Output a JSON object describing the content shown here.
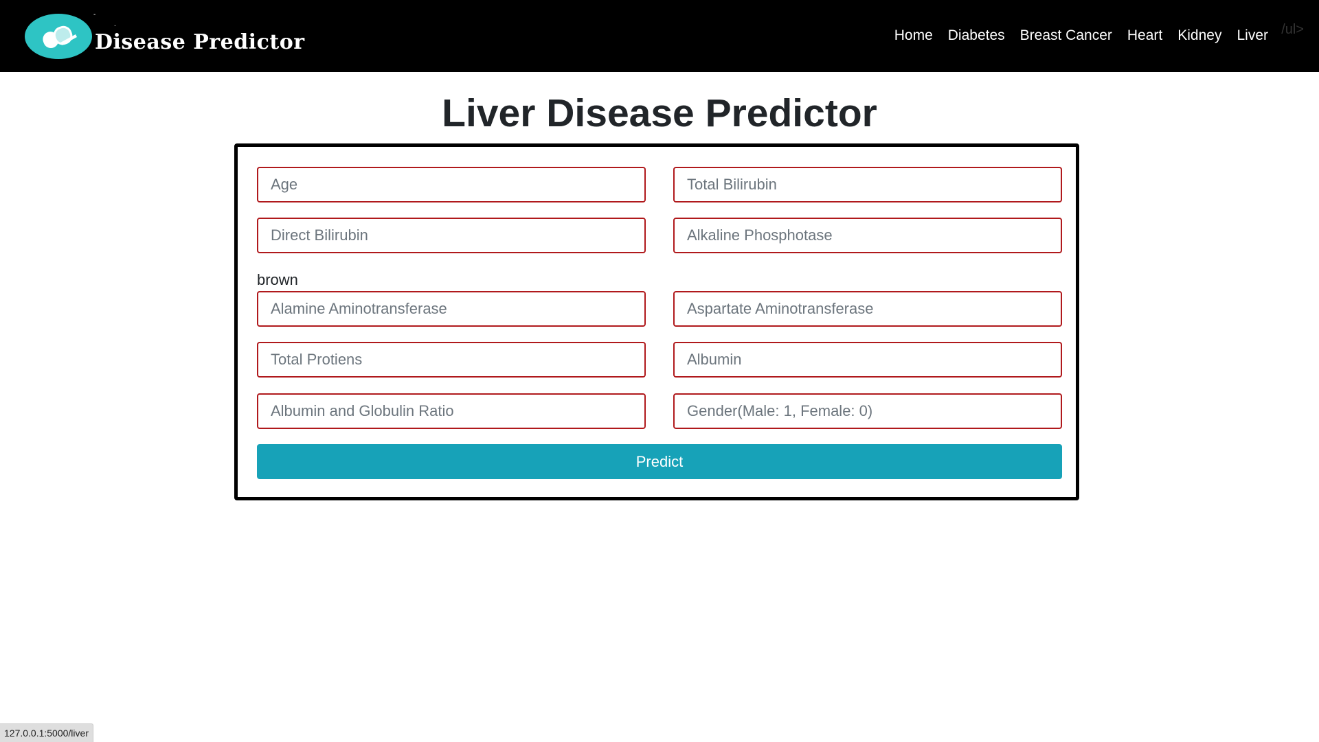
{
  "header": {
    "brand": "Disease Predictor",
    "nav": [
      {
        "label": "Home"
      },
      {
        "label": "Diabetes"
      },
      {
        "label": "Breast Cancer"
      },
      {
        "label": "Heart"
      },
      {
        "label": "Kidney"
      },
      {
        "label": "Liver"
      }
    ],
    "stray_text": "/ul>"
  },
  "main": {
    "title": "Liver Disease Predictor",
    "stray_label": "brown",
    "fields": {
      "age": {
        "placeholder": "Age",
        "value": ""
      },
      "total_bilirubin": {
        "placeholder": "Total Bilirubin",
        "value": ""
      },
      "direct_bilirubin": {
        "placeholder": "Direct Bilirubin",
        "value": ""
      },
      "alkaline_phosphotase": {
        "placeholder": "Alkaline Phosphotase",
        "value": ""
      },
      "alamine_aminotransferase": {
        "placeholder": "Alamine Aminotransferase",
        "value": ""
      },
      "aspartate_aminotransferase": {
        "placeholder": "Aspartate Aminotransferase",
        "value": ""
      },
      "total_protiens": {
        "placeholder": "Total Protiens",
        "value": ""
      },
      "albumin": {
        "placeholder": "Albumin",
        "value": ""
      },
      "albumin_globulin_ratio": {
        "placeholder": "Albumin and Globulin Ratio",
        "value": ""
      },
      "gender": {
        "placeholder": "Gender(Male: 1, Female: 0)",
        "value": ""
      }
    },
    "predict_label": "Predict"
  },
  "status_bar": {
    "url": "127.0.0.1:5000/liver"
  },
  "colors": {
    "topbar": "#000000",
    "logo_circle": "#2ec4c4",
    "field_border": "#b0191c",
    "predict_button": "#17a2b8"
  },
  "icons": {
    "logo": "pill-capsule-icon"
  }
}
